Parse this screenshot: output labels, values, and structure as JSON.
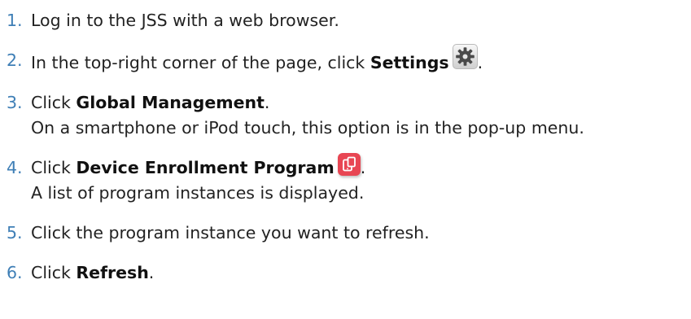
{
  "steps": [
    {
      "number": "1.",
      "parts": [
        "Log in to the JSS with a web browser."
      ]
    },
    {
      "number": "2.",
      "text_before": "In the top-right corner of the page, click ",
      "bold": "Settings",
      "icon": "settings-gear-icon",
      "text_after": "."
    },
    {
      "number": "3.",
      "text_before": "Click ",
      "bold": "Global Management",
      "text_after": ".",
      "note": "On a smartphone or iPod touch, this option is in the pop-up menu."
    },
    {
      "number": "4.",
      "text_before": "Click ",
      "bold": "Device Enrollment Program",
      "icon": "device-enrollment-icon",
      "text_after": ".",
      "note": "A list of program instances is displayed."
    },
    {
      "number": "5.",
      "parts": [
        "Click the program instance you want to refresh."
      ]
    },
    {
      "number": "6.",
      "text_before": "Click ",
      "bold": "Refresh",
      "text_after": "."
    }
  ],
  "colors": {
    "step_number": "#3f7fb6",
    "text": "#222222",
    "dep_icon": "#e84653"
  }
}
